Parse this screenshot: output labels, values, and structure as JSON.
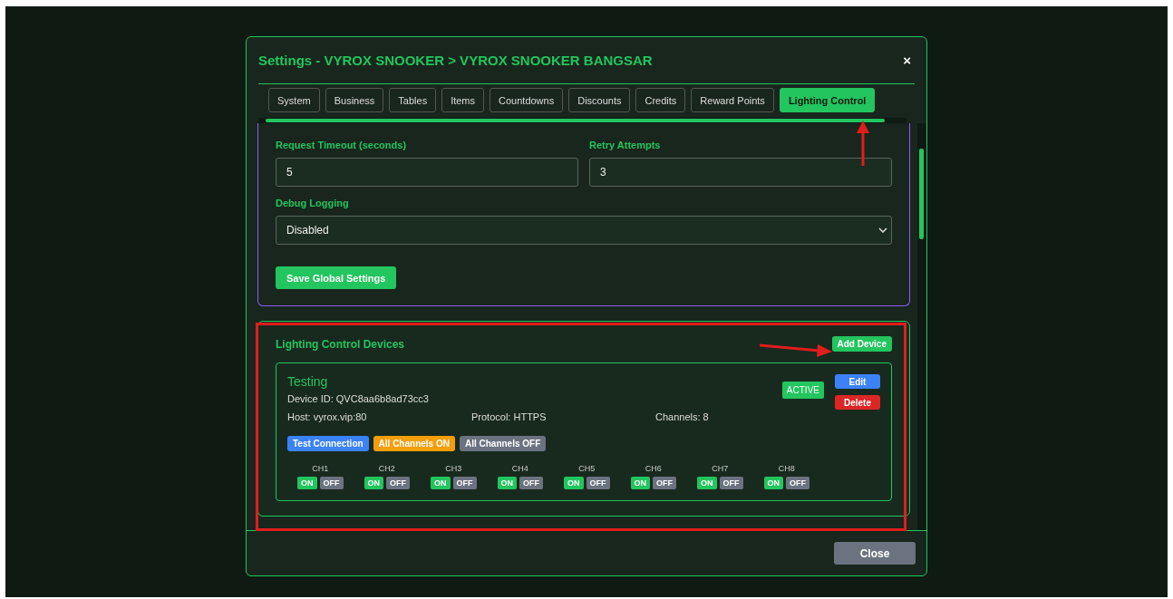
{
  "dialog": {
    "title": "Settings - VYROX SNOOKER > VYROX SNOOKER BANGSAR",
    "close_icon": "×"
  },
  "tabs": [
    {
      "label": "System",
      "selected": false
    },
    {
      "label": "Business",
      "selected": false
    },
    {
      "label": "Tables",
      "selected": false
    },
    {
      "label": "Items",
      "selected": false
    },
    {
      "label": "Countdowns",
      "selected": false
    },
    {
      "label": "Discounts",
      "selected": false
    },
    {
      "label": "Credits",
      "selected": false
    },
    {
      "label": "Reward Points",
      "selected": false
    },
    {
      "label": "Lighting Control",
      "selected": true
    }
  ],
  "global_settings": {
    "fields": [
      {
        "label": "Request Timeout (seconds)",
        "value": "5"
      },
      {
        "label": "Retry Attempts",
        "value": "3"
      }
    ],
    "debug_logging": {
      "label": "Debug Logging",
      "value": "Disabled"
    },
    "save_button": "Save Global Settings"
  },
  "devices_section": {
    "title": "Lighting Control Devices",
    "add_button": "Add Device",
    "devices": [
      {
        "name": "Testing",
        "device_id": "Device ID: QVC8aa6b8ad73cc3",
        "status": "ACTIVE",
        "edit": "Edit",
        "delete": "Delete",
        "host": "Host: vyrox.vip:80",
        "protocol": "Protocol: HTTPS",
        "channels_count": "Channels: 8",
        "actions": [
          {
            "label": "Test Connection",
            "color": "#3b82f6"
          },
          {
            "label": "All Channels ON",
            "color": "#f59e0b"
          },
          {
            "label": "All Channels OFF",
            "color": "#6b7280"
          }
        ],
        "channels": [
          {
            "label": "CH1",
            "on": "ON",
            "off": "OFF"
          },
          {
            "label": "CH2",
            "on": "ON",
            "off": "OFF"
          },
          {
            "label": "CH3",
            "on": "ON",
            "off": "OFF"
          },
          {
            "label": "CH4",
            "on": "ON",
            "off": "OFF"
          },
          {
            "label": "CH5",
            "on": "ON",
            "off": "OFF"
          },
          {
            "label": "CH6",
            "on": "ON",
            "off": "OFF"
          },
          {
            "label": "CH7",
            "on": "ON",
            "off": "OFF"
          },
          {
            "label": "CH8",
            "on": "ON",
            "off": "OFF"
          }
        ]
      }
    ]
  },
  "footer": {
    "close_button": "Close"
  }
}
